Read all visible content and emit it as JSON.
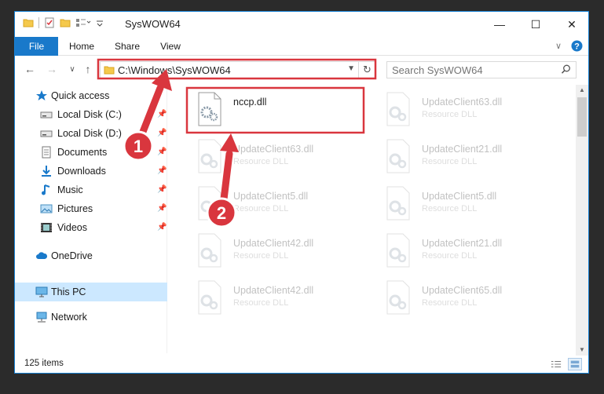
{
  "window": {
    "title": "SysWOW64",
    "minimize": "—",
    "maximize": "☐",
    "close": "✕"
  },
  "ribbon": {
    "tabs": [
      "File",
      "Home",
      "Share",
      "View"
    ]
  },
  "nav": {
    "back": "←",
    "forward": "→",
    "recent": "∨",
    "up": "↑"
  },
  "address": {
    "path": "C:\\Windows\\SysWOW64",
    "dropdown": "▼",
    "refresh": "↻"
  },
  "search": {
    "placeholder": "Search SysWOW64"
  },
  "sidebar": {
    "quick_access": "Quick access",
    "items": [
      "Local Disk (C:)",
      "Local Disk (D:)",
      "Documents",
      "Downloads",
      "Music",
      "Pictures",
      "Videos"
    ],
    "onedrive": "OneDrive",
    "thispc": "This PC",
    "network": "Network"
  },
  "files": [
    {
      "name": "nccp.dll",
      "type": ""
    },
    {
      "name": "UpdateClient63.dll",
      "type": "Resource DLL"
    },
    {
      "name": "UpdateClient63.dll",
      "type": "Resource DLL"
    },
    {
      "name": "UpdateClient21.dll",
      "type": "Resource DLL"
    },
    {
      "name": "UpdateClient5.dll",
      "type": "Resource DLL"
    },
    {
      "name": "UpdateClient5.dll",
      "type": "Resource DLL"
    },
    {
      "name": "UpdateClient42.dll",
      "type": "Resource DLL"
    },
    {
      "name": "UpdateClient21.dll",
      "type": "Resource DLL"
    },
    {
      "name": "UpdateClient42.dll",
      "type": "Resource DLL"
    },
    {
      "name": "UpdateClient65.dll",
      "type": "Resource DLL"
    }
  ],
  "status": {
    "count": "125 items"
  },
  "annotations": {
    "step1": "1",
    "step2": "2",
    "color": "#d9363e"
  },
  "colors": {
    "accent": "#1979ca",
    "selection": "#cce8ff",
    "highlight": "#d9363e"
  }
}
